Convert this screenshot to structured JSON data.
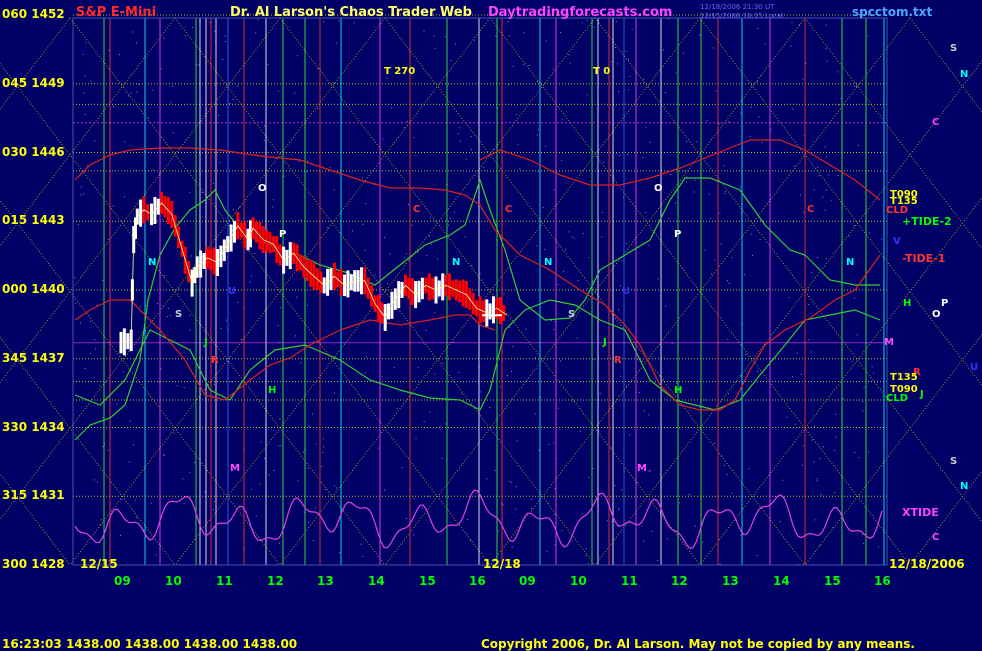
{
  "header": {
    "title_left": "S&P E-Mini",
    "title_center": "Dr. Al Larson's Chaos Trader Web",
    "site": "Daytradingforecasts.com",
    "stamp_line1": "12/18/2006 21:30 UT",
    "stamp_line2": "12/15/2006 16:15 Local",
    "file": "spcctom.txt"
  },
  "footer": {
    "time": "16:23:03",
    "ohlc": "1438.00 1438.00 1438.00 1438.00",
    "copyright": "Copyright 2006, Dr. Al Larson. May not be copied by any means."
  },
  "dates": {
    "start": "12/15",
    "mid": "12/18",
    "end": "12/18/2006"
  },
  "colors": {
    "background": "#000066",
    "price_axis": "#ffff00",
    "hours": "#00ff00",
    "up_bar": "#ffffff",
    "down_bar": "#ff0000"
  },
  "chart_data": {
    "type": "line",
    "title": "S&P E-Mini",
    "ylim": [
      1428,
      1452
    ],
    "y_ticks": [
      {
        "left": "300",
        "price": 1428
      },
      {
        "left": "315",
        "price": 1431
      },
      {
        "left": "330",
        "price": 1434
      },
      {
        "left": "345",
        "price": 1437
      },
      {
        "left": "000",
        "price": 1440
      },
      {
        "left": "015",
        "price": 1443
      },
      {
        "left": "030",
        "price": 1446
      },
      {
        "left": "045",
        "price": 1449
      },
      {
        "left": "060",
        "price": 1452
      }
    ],
    "x_ticks": [
      "09",
      "10",
      "11",
      "12",
      "13",
      "14",
      "15",
      "16",
      "09",
      "10",
      "11",
      "12",
      "13",
      "14",
      "15",
      "16"
    ],
    "price_series": [
      [
        0,
        1437.7
      ],
      [
        0.2,
        1437.8
      ],
      [
        0.25,
        1442.2
      ],
      [
        0.32,
        1443.2
      ],
      [
        0.45,
        1443.5
      ],
      [
        0.6,
        1443.3
      ],
      [
        0.8,
        1443.8
      ],
      [
        1.0,
        1443.3
      ],
      [
        1.2,
        1441.8
      ],
      [
        1.4,
        1440.3
      ],
      [
        1.5,
        1441.0
      ],
      [
        1.7,
        1441.4
      ],
      [
        1.9,
        1441.2
      ],
      [
        2.1,
        1442.0
      ],
      [
        2.3,
        1442.8
      ],
      [
        2.5,
        1442.2
      ],
      [
        2.6,
        1442.7
      ],
      [
        2.8,
        1442.2
      ],
      [
        3.0,
        1442.0
      ],
      [
        3.2,
        1441.3
      ],
      [
        3.4,
        1441.6
      ],
      [
        3.6,
        1441.0
      ],
      [
        3.8,
        1440.6
      ],
      [
        4.0,
        1440.2
      ],
      [
        4.2,
        1440.6
      ],
      [
        4.4,
        1440.2
      ],
      [
        4.6,
        1440.4
      ],
      [
        4.8,
        1440.4
      ],
      [
        5.0,
        1439.4
      ],
      [
        5.2,
        1438.8
      ],
      [
        5.4,
        1439.6
      ],
      [
        5.6,
        1440.2
      ],
      [
        5.8,
        1439.8
      ],
      [
        6.0,
        1440.2
      ],
      [
        6.2,
        1440.0
      ],
      [
        6.4,
        1440.2
      ],
      [
        6.6,
        1440.0
      ],
      [
        6.8,
        1439.8
      ],
      [
        7.0,
        1439.2
      ],
      [
        7.2,
        1439.0
      ],
      [
        7.4,
        1439.2
      ],
      [
        7.6,
        1438.9
      ]
    ],
    "series_labels": [
      "+TIDE-2",
      "-TIDE-1",
      "XTIDE"
    ],
    "time_lines": [
      {
        "label": "T 270",
        "day": 1,
        "hour": 14.2
      },
      {
        "label": "T 0",
        "day": 2,
        "hour": 10.5
      }
    ],
    "right_levels": [
      {
        "label": "T090",
        "price": 1444.1,
        "color": "#ffff00"
      },
      {
        "label": "T135",
        "price": 1443.8,
        "color": "#ffff00"
      },
      {
        "label": "CLD",
        "price": 1443.4,
        "color": "#ff3333"
      },
      {
        "label": "T135",
        "price": 1436.1,
        "color": "#ffff00"
      },
      {
        "label": "T090",
        "price": 1435.6,
        "color": "#ffff00"
      },
      {
        "label": "CLD",
        "price": 1435.2,
        "color": "#00ff00"
      }
    ],
    "planet_markers_right": [
      {
        "label": "S",
        "price": 1450.5,
        "color": "#cccccc"
      },
      {
        "label": "N",
        "price": 1449.4,
        "color": "#00ffff"
      },
      {
        "label": "C",
        "price": 1447.3,
        "color": "#ff44ff"
      },
      {
        "label": "V",
        "price": 1442.1,
        "color": "#3333ff"
      },
      {
        "label": "H",
        "price": 1439.4,
        "color": "#00ff00"
      },
      {
        "label": "P",
        "price": 1439.4,
        "color": "#ffffff"
      },
      {
        "label": "O",
        "price": 1438.9,
        "color": "#ffffff"
      },
      {
        "label": "M",
        "price": 1437.7,
        "color": "#ff44ff"
      },
      {
        "label": "R",
        "price": 1436.4,
        "color": "#ff3333"
      },
      {
        "label": "J",
        "price": 1435.4,
        "color": "#00ff00"
      },
      {
        "label": "U",
        "price": 1436.6,
        "color": "#3333ff"
      },
      {
        "label": "S",
        "price": 1432.5,
        "color": "#cccccc"
      },
      {
        "label": "N",
        "price": 1431.4,
        "color": "#00ffff"
      },
      {
        "label": "C",
        "price": 1429.2,
        "color": "#ff44ff"
      }
    ],
    "planet_markers_chart": [
      {
        "label": "O",
        "x": 258,
        "price": 1444.4,
        "color": "#ffffff"
      },
      {
        "label": "C",
        "x": 413,
        "price": 1443.5,
        "color": "#ff3333"
      },
      {
        "label": "C",
        "x": 505,
        "price": 1443.5,
        "color": "#ff3333"
      },
      {
        "label": "O",
        "x": 654,
        "price": 1444.4,
        "color": "#ffffff"
      },
      {
        "label": "C",
        "x": 807,
        "price": 1443.5,
        "color": "#ff3333"
      },
      {
        "label": "P",
        "x": 279,
        "price": 1442.4,
        "color": "#ffffff"
      },
      {
        "label": "P",
        "x": 674,
        "price": 1442.4,
        "color": "#ffffff"
      },
      {
        "label": "N",
        "x": 148,
        "price": 1441.2,
        "color": "#00ffff"
      },
      {
        "label": "N",
        "x": 452,
        "price": 1441.2,
        "color": "#00ffff"
      },
      {
        "label": "N",
        "x": 544,
        "price": 1441.2,
        "color": "#00ffff"
      },
      {
        "label": "N",
        "x": 846,
        "price": 1441.2,
        "color": "#00ffff"
      },
      {
        "label": "U",
        "x": 228,
        "price": 1439.9,
        "color": "#3333ff"
      },
      {
        "label": "U",
        "x": 622,
        "price": 1439.9,
        "color": "#3333ff"
      },
      {
        "label": "S",
        "x": 175,
        "price": 1438.9,
        "color": "#cccccc"
      },
      {
        "label": "S",
        "x": 568,
        "price": 1438.9,
        "color": "#cccccc"
      },
      {
        "label": "J",
        "x": 204,
        "price": 1437.7,
        "color": "#00ff00"
      },
      {
        "label": "J",
        "x": 603,
        "price": 1437.7,
        "color": "#00ff00"
      },
      {
        "label": "R",
        "x": 211,
        "price": 1436.9,
        "color": "#ff3333"
      },
      {
        "label": "R",
        "x": 614,
        "price": 1436.9,
        "color": "#ff3333"
      },
      {
        "label": "H",
        "x": 268,
        "price": 1435.6,
        "color": "#00ff00"
      },
      {
        "label": "H",
        "x": 674,
        "price": 1435.6,
        "color": "#00ff00"
      },
      {
        "label": "M",
        "x": 230,
        "price": 1432.2,
        "color": "#ff44ff"
      },
      {
        "label": "M",
        "x": 637,
        "price": 1432.2,
        "color": "#ff44ff"
      }
    ]
  }
}
